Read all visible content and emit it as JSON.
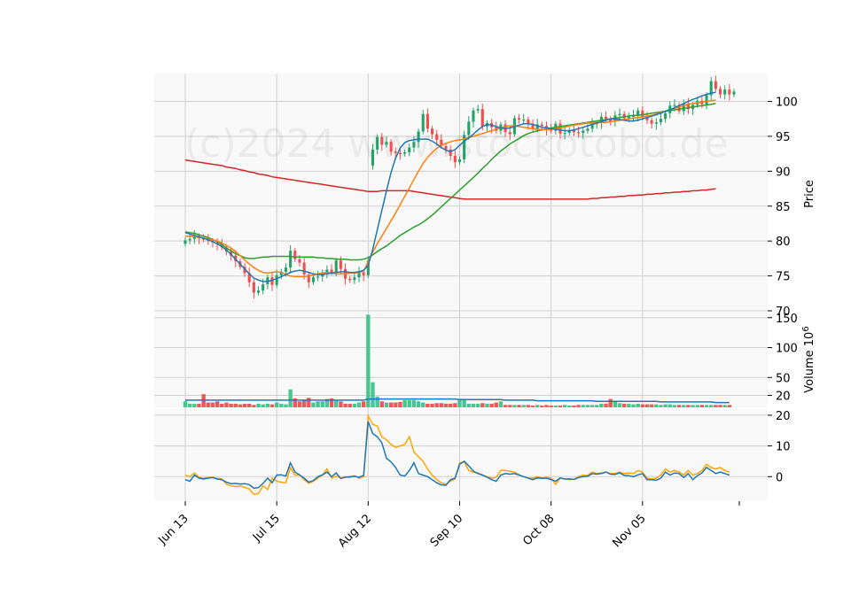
{
  "watermark": "(c)2024 www.stockotobd.de",
  "colors": {
    "up": "#26a269",
    "up_fill": "#3ec38a",
    "down": "#ef4e4e",
    "ma_short": "#1f77b4",
    "ma_mid": "#ff7f0e",
    "ma_long": "#2ca02c",
    "ma_200": "#d62728",
    "osc_a": "#1f77b4",
    "osc_b": "#ffa500",
    "grid": "#d0d0d0",
    "panel_bg": "#f8f8f8"
  },
  "chart_data": [
    {
      "type": "candlestick",
      "panel": "price",
      "ylabel": "Price",
      "ylim": [
        70,
        104
      ],
      "yticks": [
        70,
        75,
        80,
        85,
        90,
        95,
        100
      ],
      "xlabel": "",
      "x_tick_labels": [
        "Jun 13",
        "Jul 15",
        "Aug 12",
        "Sep 10",
        "Oct 08",
        "Nov 05"
      ],
      "x_tick_index": [
        0,
        20,
        40,
        60,
        80,
        100
      ],
      "close": [
        80.1,
        80.3,
        80.7,
        80.4,
        80.2,
        80.0,
        79.8,
        79.5,
        79.1,
        78.5,
        77.9,
        77.1,
        76.3,
        75.4,
        74.1,
        72.6,
        72.9,
        73.8,
        74.8,
        73.7,
        75.1,
        75.6,
        76.2,
        78.6,
        77.4,
        76.9,
        75.2,
        74.1,
        74.8,
        74.9,
        75.5,
        75.9,
        75.5,
        77.2,
        76.0,
        74.6,
        74.4,
        74.8,
        75.5,
        75.1,
        77.2,
        93.1,
        94.9,
        93.8,
        94.2,
        92.8,
        92.6,
        92.5,
        92.7,
        93.4,
        94.2,
        95.7,
        98.2,
        96.1,
        95.3,
        94.5,
        93.6,
        93.1,
        92.2,
        91.3,
        91.7,
        95.2,
        97.1,
        98.7,
        98.9,
        96.4,
        96.9,
        96.3,
        95.8,
        96.7,
        95.6,
        95.3,
        97.6,
        97.4,
        97.4,
        96.8,
        96.1,
        96.7,
        96.5,
        96.0,
        95.8,
        96.8,
        95.4,
        95.5,
        95.9,
        95.6,
        95.5,
        95.8,
        96.1,
        96.8,
        96.9,
        97.8,
        97.5,
        97.1,
        98.0,
        98.2,
        97.6,
        97.8,
        98.0,
        98.7,
        97.7,
        97.3,
        96.8,
        97.0,
        97.5,
        98.3,
        99.4,
        99.5,
        98.6,
        99.7,
        98.9,
        99.5,
        100.1,
        99.6,
        100.9,
        102.9,
        101.8,
        101.0,
        101.7,
        101.0,
        101.4
      ],
      "open": [
        79.6,
        80.1,
        80.3,
        80.7,
        80.4,
        80.2,
        80.0,
        79.8,
        79.5,
        79.1,
        78.5,
        77.9,
        77.1,
        76.3,
        75.4,
        74.1,
        72.6,
        72.9,
        73.8,
        74.8,
        73.7,
        75.1,
        75.6,
        76.2,
        78.6,
        77.4,
        76.9,
        75.2,
        74.1,
        74.8,
        74.9,
        75.5,
        75.9,
        75.5,
        77.2,
        76.0,
        74.6,
        74.4,
        74.8,
        75.5,
        75.1,
        90.8,
        93.1,
        94.9,
        93.8,
        94.2,
        92.8,
        92.6,
        92.5,
        92.7,
        93.4,
        94.2,
        95.7,
        98.2,
        96.1,
        95.3,
        94.5,
        93.6,
        93.1,
        92.2,
        91.3,
        91.7,
        95.2,
        97.1,
        98.7,
        98.9,
        96.4,
        96.9,
        96.3,
        95.8,
        96.7,
        95.6,
        95.3,
        97.6,
        97.4,
        97.4,
        96.8,
        96.1,
        96.7,
        96.5,
        96.0,
        95.8,
        96.8,
        95.4,
        95.5,
        95.9,
        95.6,
        95.5,
        95.8,
        96.1,
        96.8,
        96.9,
        97.8,
        97.5,
        97.1,
        98.0,
        98.2,
        97.6,
        97.8,
        98.0,
        98.7,
        97.7,
        97.3,
        96.8,
        97.0,
        97.5,
        98.3,
        99.4,
        99.5,
        98.6,
        99.7,
        98.9,
        99.5,
        100.1,
        99.6,
        100.9,
        102.9,
        101.8,
        101.0,
        101.7,
        101.0
      ],
      "ma_short": [
        81.2,
        81.0,
        80.8,
        80.6,
        80.4,
        80.2,
        79.9,
        79.6,
        79.2,
        78.7,
        78.1,
        77.4,
        76.7,
        76.0,
        75.3,
        74.7,
        74.4,
        74.2,
        74.2,
        74.4,
        74.6,
        74.9,
        75.2,
        75.5,
        75.7,
        75.8,
        75.7,
        75.5,
        75.3,
        75.2,
        75.2,
        75.3,
        75.4,
        75.5,
        75.6,
        75.6,
        75.5,
        75.5,
        75.6,
        75.8,
        76.5,
        78.8,
        81.6,
        84.4,
        87.2,
        89.8,
        91.9,
        93.3,
        94.1,
        94.4,
        94.5,
        94.6,
        94.6,
        94.6,
        94.3,
        93.9,
        93.4,
        93.0,
        92.8,
        93.1,
        93.7,
        94.3,
        94.8,
        95.3,
        95.9,
        96.4,
        96.7,
        96.6,
        96.4,
        96.2,
        96.1,
        96.2,
        96.4,
        96.6,
        96.8,
        96.8,
        96.7,
        96.5,
        96.3,
        96.2,
        96.1,
        96.0,
        95.9,
        95.8,
        95.8,
        95.9,
        96.1,
        96.3,
        96.5,
        96.7,
        96.9,
        97.1,
        97.3,
        97.5,
        97.5,
        97.4,
        97.3,
        97.2,
        97.2,
        97.3,
        97.5,
        97.7,
        97.9,
        98.1,
        98.3,
        98.6,
        98.8,
        99.1,
        99.4,
        99.7,
        100.0,
        100.3,
        100.5,
        100.8,
        101.0,
        101.2,
        101.3
      ],
      "ma_mid": [
        80.7,
        80.7,
        80.6,
        80.5,
        80.4,
        80.3,
        80.2,
        80.0,
        79.7,
        79.4,
        79.0,
        78.5,
        77.9,
        77.3,
        76.7,
        76.2,
        75.8,
        75.5,
        75.4,
        75.5,
        75.6,
        75.5,
        75.2,
        75.0,
        74.9,
        74.9,
        74.9,
        75.0,
        75.1,
        75.3,
        75.4,
        75.5,
        75.4,
        75.3,
        75.3,
        75.3,
        75.4,
        75.4,
        75.5,
        75.7,
        77.0,
        78.4,
        79.6,
        80.7,
        81.8,
        82.9,
        84.0,
        85.2,
        86.4,
        87.6,
        88.8,
        90.0,
        91.1,
        92.0,
        92.7,
        93.3,
        93.7,
        94.0,
        94.2,
        94.4,
        94.5,
        94.6,
        94.8,
        95.0,
        95.2,
        95.4,
        95.6,
        95.8,
        96.0,
        96.2,
        96.4,
        96.5,
        96.5,
        96.4,
        96.3,
        96.2,
        96.1,
        96.0,
        96.0,
        96.0,
        96.0,
        96.1,
        96.2,
        96.3,
        96.5,
        96.6,
        96.7,
        96.8,
        96.9,
        96.9,
        97.0,
        97.0,
        97.0,
        97.1,
        97.2,
        97.3,
        97.4,
        97.5,
        97.6,
        97.7,
        97.8,
        97.9,
        98.0,
        98.2,
        98.4,
        98.6,
        98.8,
        99.0,
        99.2,
        99.4,
        99.6,
        99.7,
        99.8,
        99.9,
        100.0,
        100.1,
        100.2
      ],
      "ma_long": [
        81.3,
        81.2,
        81.1,
        80.9,
        80.7,
        80.5,
        80.2,
        79.9,
        79.5,
        79.0,
        78.6,
        78.2,
        77.9,
        77.6,
        77.5,
        77.5,
        77.6,
        77.7,
        77.7,
        77.8,
        77.8,
        77.8,
        77.8,
        77.8,
        77.7,
        77.7,
        77.7,
        77.7,
        77.7,
        77.6,
        77.6,
        77.5,
        77.5,
        77.4,
        77.4,
        77.4,
        77.3,
        77.3,
        77.3,
        77.4,
        77.6,
        78.0,
        78.5,
        78.9,
        79.3,
        79.8,
        80.3,
        80.8,
        81.2,
        81.6,
        82.0,
        82.3,
        82.7,
        83.2,
        83.7,
        84.3,
        84.9,
        85.5,
        86.1,
        86.7,
        87.3,
        87.9,
        88.5,
        89.1,
        89.7,
        90.4,
        91.0,
        91.7,
        92.3,
        92.9,
        93.4,
        93.9,
        94.3,
        94.7,
        95.1,
        95.4,
        95.6,
        95.8,
        95.9,
        96.1,
        96.2,
        96.3,
        96.4,
        96.5,
        96.6,
        96.7,
        96.8,
        96.9,
        97.0,
        97.1,
        97.2,
        97.3,
        97.4,
        97.5,
        97.6,
        97.7,
        97.8,
        97.9,
        98.0,
        98.0,
        98.1,
        98.2,
        98.3,
        98.4,
        98.5,
        98.6,
        98.7,
        98.8,
        98.9,
        99.0,
        99.1,
        99.2,
        99.3,
        99.4,
        99.5,
        99.6,
        99.7
      ],
      "ma_200": [
        91.6,
        91.5,
        91.4,
        91.3,
        91.2,
        91.1,
        91.0,
        90.9,
        90.8,
        90.6,
        90.5,
        90.4,
        90.2,
        90.1,
        89.9,
        89.8,
        89.6,
        89.5,
        89.4,
        89.2,
        89.1,
        89.0,
        88.9,
        88.8,
        88.7,
        88.6,
        88.5,
        88.4,
        88.3,
        88.2,
        88.1,
        88.0,
        87.9,
        87.8,
        87.7,
        87.6,
        87.5,
        87.4,
        87.3,
        87.2,
        87.1,
        87.1,
        87.1,
        87.2,
        87.2,
        87.2,
        87.2,
        87.2,
        87.2,
        87.2,
        87.1,
        87.0,
        86.9,
        86.8,
        86.7,
        86.6,
        86.5,
        86.4,
        86.3,
        86.2,
        86.1,
        86.0,
        86.0,
        86.0,
        86.0,
        86.0,
        86.0,
        86.0,
        86.0,
        86.0,
        86.0,
        86.0,
        86.0,
        86.0,
        86.0,
        86.0,
        86.0,
        86.0,
        86.0,
        86.0,
        86.0,
        86.0,
        86.0,
        86.0,
        86.0,
        86.0,
        86.0,
        86.0,
        86.0,
        86.1,
        86.1,
        86.2,
        86.2,
        86.3,
        86.3,
        86.4,
        86.4,
        86.5,
        86.5,
        86.6,
        86.6,
        86.7,
        86.7,
        86.8,
        86.8,
        86.9,
        86.9,
        87.0,
        87.0,
        87.1,
        87.1,
        87.2,
        87.2,
        87.3,
        87.3,
        87.4,
        87.5
      ]
    },
    {
      "type": "bar",
      "panel": "volume",
      "ylabel": "Volume  10^6",
      "ylim": [
        0,
        160
      ],
      "yticks": [
        20,
        50,
        100,
        150
      ],
      "values": [
        10,
        6,
        6,
        6,
        22,
        8,
        8,
        10,
        6,
        8,
        6,
        6,
        5,
        6,
        6,
        4,
        6,
        5,
        6,
        5,
        8,
        6,
        5,
        30,
        15,
        10,
        12,
        16,
        8,
        10,
        10,
        14,
        15,
        12,
        10,
        6,
        6,
        6,
        8,
        10,
        155,
        42,
        18,
        10,
        8,
        8,
        8,
        9,
        12,
        12,
        12,
        10,
        8,
        6,
        6,
        7,
        7,
        6,
        6,
        7,
        14,
        12,
        6,
        6,
        6,
        7,
        6,
        6,
        8,
        10,
        4,
        4,
        4,
        4,
        4,
        4,
        3,
        4,
        3,
        4,
        3,
        3,
        3,
        4,
        3,
        3,
        4,
        4,
        4,
        4,
        4,
        6,
        6,
        14,
        10,
        7,
        6,
        6,
        5,
        6,
        5,
        5,
        5,
        5,
        4,
        5,
        5,
        4,
        4,
        4,
        4,
        4,
        4,
        4,
        4,
        4,
        4,
        4,
        4,
        4
      ],
      "avg_line": [
        12,
        12,
        12,
        12,
        12,
        12,
        12,
        12,
        12,
        12,
        12,
        12,
        12,
        12,
        12,
        12,
        12,
        12,
        12,
        12,
        12,
        12,
        12,
        12,
        12,
        12,
        12,
        12,
        12,
        12,
        12,
        12,
        12,
        12,
        12,
        12,
        12,
        12,
        12,
        12,
        14,
        14,
        14,
        14,
        14,
        14,
        14,
        14,
        14,
        14,
        14,
        14,
        14,
        14,
        14,
        14,
        14,
        14,
        14,
        14,
        13,
        13,
        13,
        13,
        13,
        13,
        13,
        13,
        13,
        13,
        12,
        12,
        12,
        12,
        12,
        12,
        12,
        11,
        11,
        11,
        11,
        11,
        11,
        11,
        11,
        11,
        11,
        11,
        11,
        11,
        10,
        10,
        10,
        10,
        10,
        10,
        10,
        10,
        10,
        10,
        10,
        10,
        10,
        10,
        9,
        9,
        9,
        9,
        9,
        9,
        9,
        9,
        9,
        9,
        9,
        9,
        8,
        8,
        8,
        8
      ]
    },
    {
      "type": "line",
      "panel": "oscillator",
      "ylim": [
        -8,
        22
      ],
      "yticks": [
        0,
        10,
        20
      ],
      "series_a": [
        -1,
        -1.5,
        0.5,
        -0.5,
        -0.8,
        -0.5,
        -0.3,
        -0.8,
        -1.0,
        -1.8,
        -2.3,
        -2.2,
        -2.4,
        -2.3,
        -2.6,
        -3.8,
        -3.6,
        -2.2,
        -0.5,
        -2.0,
        0.5,
        0.6,
        0.2,
        4.5,
        1.5,
        0.6,
        -0.5,
        -1.8,
        -1.3,
        0.0,
        0.6,
        1.5,
        0.0,
        1.2,
        -0.6,
        -0.2,
        0.0,
        0.1,
        -0.2,
        0.4,
        18.0,
        14.0,
        13.0,
        11.0,
        6.0,
        4.8,
        3.0,
        0.5,
        0.2,
        2.0,
        4.5,
        1.0,
        0.5,
        0.0,
        -1.0,
        -2.0,
        -2.7,
        -2.8,
        -1.0,
        -0.5,
        4.0,
        5.0,
        3.5,
        1.8,
        1.0,
        0.5,
        -0.2,
        -1.0,
        -1.5,
        0.5,
        1.0,
        0.8,
        1.0,
        0.5,
        0.0,
        -0.5,
        -1.0,
        -0.4,
        -0.6,
        -0.5,
        -1.0,
        -1.5,
        -0.4,
        -0.8,
        -0.7,
        -0.9,
        -0.3,
        0.0,
        0.1,
        1.0,
        0.8,
        1.0,
        1.5,
        0.8,
        0.7,
        1.2,
        0.4,
        0.3,
        0.0,
        0.6,
        1.0,
        -1.0,
        -1.0,
        -1.2,
        -0.5,
        1.5,
        0.5,
        1.2,
        1.0,
        -0.3,
        1.0,
        -1.0,
        0.3,
        1.2,
        3.0,
        2.0,
        1.0,
        1.5,
        1.0,
        0.5
      ],
      "series_b": [
        0.5,
        0.0,
        1.2,
        -0.2,
        -0.5,
        -0.3,
        -0.2,
        -0.6,
        -0.7,
        -2.5,
        -3.0,
        -3.2,
        -3.1,
        -3.5,
        -4.0,
        -5.8,
        -5.5,
        -3.0,
        -4.2,
        -0.5,
        -1.5,
        -1.8,
        -2.0,
        3.0,
        0.5,
        0.5,
        -1.0,
        -2.2,
        -1.5,
        -0.5,
        0.5,
        2.5,
        -0.5,
        0.2,
        -0.5,
        0.0,
        -0.3,
        0.3,
        -0.5,
        0.0,
        19.8,
        17.0,
        16.5,
        13.0,
        12.0,
        10.5,
        9.5,
        10.0,
        10.5,
        13.0,
        8.0,
        6.5,
        5.0,
        2.5,
        0.5,
        -1.0,
        -2.0,
        -2.5,
        -1.5,
        -0.8,
        4.5,
        4.8,
        2.0,
        1.5,
        1.2,
        0.5,
        0.0,
        -0.5,
        -0.2,
        2.0,
        2.0,
        1.8,
        1.5,
        0.5,
        0.0,
        -0.5,
        -0.5,
        0.0,
        -0.5,
        -0.2,
        -0.5,
        -2.5,
        -0.5,
        -0.7,
        -1.0,
        -0.8,
        0.0,
        0.5,
        0.4,
        1.5,
        1.0,
        1.2,
        1.5,
        1.0,
        1.0,
        1.5,
        1.0,
        1.2,
        1.0,
        2.0,
        1.5,
        -0.5,
        -0.8,
        -0.5,
        0.5,
        2.5,
        1.5,
        2.0,
        1.5,
        0.5,
        2.0,
        0.5,
        1.0,
        2.0,
        4.0,
        3.0,
        2.5,
        3.0,
        2.0,
        1.5
      ]
    }
  ]
}
